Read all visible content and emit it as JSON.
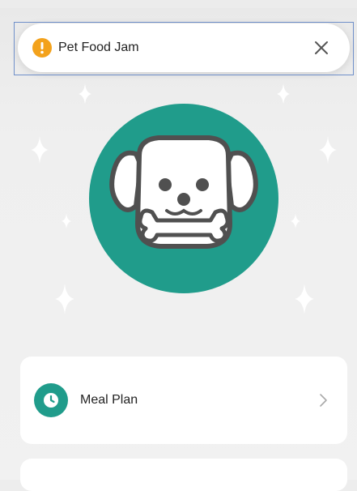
{
  "alert": {
    "title": "Pet Food Jam",
    "icon": "warning-icon",
    "icon_color": "#f3a21c",
    "close_icon": "close-icon"
  },
  "hero": {
    "icon": "dog-with-bone-icon",
    "color": "#209c8b"
  },
  "menu": {
    "items": [
      {
        "label": "Meal Plan",
        "icon": "clock-icon",
        "chevron": "chevron-right-icon"
      }
    ]
  }
}
